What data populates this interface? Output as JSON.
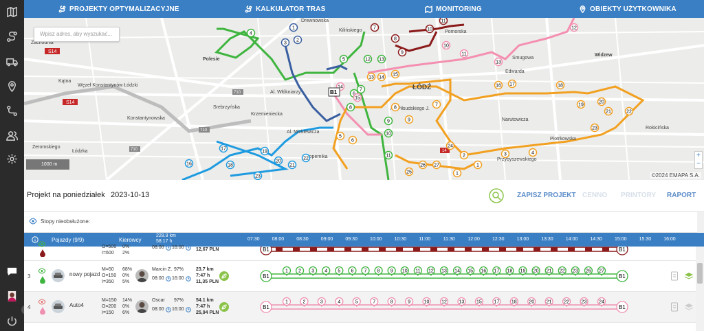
{
  "nav": {
    "items": [
      {
        "label": "PROJEKTY OPTYMALIZACYJNE",
        "icon": "route-icon"
      },
      {
        "label": "KALKULATOR TRAS",
        "icon": "route-icon"
      },
      {
        "label": "MONITORING",
        "icon": "map-icon"
      },
      {
        "label": "OBIEKTY UŻYTKOWNIKA",
        "icon": "pin-icon"
      }
    ]
  },
  "map": {
    "search_placeholder": "Wpisz adres, aby wyszukać...",
    "copyright": "©2024 EMAPA S.A.",
    "scale_label": "1000 m",
    "zoom_in": "+",
    "zoom_out": "−",
    "labels": [
      "Drewnowska",
      "Pomorska",
      "Widzew",
      "Polesie",
      "Zachodnia",
      "Węzeł Konstantynów Łódzki",
      "S14",
      "710",
      "ŁÓDŹ",
      "Al. Piłsudskiego J.",
      "Srebrzyńska",
      "Konstantynowska",
      "Krzemieniecka",
      "Żeromskiego",
      "Kopernika",
      "Al. Włókniarzy",
      "Przybyszewskiego",
      "Rokicińska",
      "Łódzka",
      "Kilińskiego",
      "Narutowicza",
      "Piotrkowska",
      "Al. Mickiewicza",
      "Smugowa",
      "Edwarda",
      "Kątna"
    ],
    "stops_text": [
      "B1"
    ]
  },
  "project": {
    "name": "Projekt na poniedziałek",
    "date": "2023-10-13",
    "buttons": [
      {
        "label": "ZAPISZ PROJEKT",
        "enabled": true
      },
      {
        "label": "CENNO",
        "enabled": false
      },
      {
        "label": "PRINTORY",
        "enabled": false
      },
      {
        "label": "RAPORT",
        "enabled": true
      }
    ]
  },
  "unserved": {
    "label": "Stopy nieobsłużone:"
  },
  "table": {
    "vehicles_header": "Pojazdy (9/9)",
    "drivers_header": "Kierowcy",
    "total_km": "228.9 km",
    "total_time": "58:17 h",
    "times": [
      "07:30",
      "08:00",
      "08:30",
      "09:00",
      "09:30",
      "10:00",
      "10:30",
      "11:00",
      "11:30",
      "12:00",
      "12:30",
      "13:00",
      "13:30",
      "14:00",
      "14:30",
      "15:00",
      "15:30",
      "16:00"
    ],
    "rows": [
      {
        "num": "",
        "vehicle": "",
        "caps": [
          "O=500",
          "I=600"
        ],
        "pcts": [
          "0%",
          "2%"
        ],
        "driver": "",
        "pct": "",
        "start": "08:00",
        "end": "16:00",
        "km": "",
        "time": "",
        "cost": "12,67 PLN",
        "color": "#8b1a1a",
        "depot": "B1",
        "stops": [],
        "partial": true
      },
      {
        "num": "3",
        "vehicle": "nowy pojazd",
        "caps": [
          "M=50",
          "O=150",
          "I=350"
        ],
        "pcts": [
          "68%",
          "0%",
          "5%"
        ],
        "driver": "Marcin Z.",
        "pct": "97%",
        "start": "08:00",
        "end": "16:00",
        "km": "23.7 km",
        "time": "7:47 h",
        "cost": "11,35 PLN",
        "color": "#3fb53f",
        "depot": "B1",
        "stops": [
          "1",
          "2",
          "3",
          "4",
          "5",
          "6",
          "7",
          "8",
          "9",
          "10",
          "11",
          "12",
          "13",
          "14",
          "15",
          "16",
          "17",
          "18",
          "19",
          "20",
          "21",
          "22",
          "23",
          "26",
          "27"
        ]
      },
      {
        "num": "4",
        "vehicle": "Auto4",
        "caps": [
          "M=150",
          "O=200",
          "I=150"
        ],
        "pcts": [
          "14%",
          "0%",
          "6%"
        ],
        "driver": "Oscar",
        "pct": "97%",
        "start": "08:00",
        "end": "16:00",
        "km": "54.1 km",
        "time": "7:47 h",
        "cost": "25,94 PLN",
        "color": "#f08fb0",
        "depot": "B1",
        "stops": [
          "1",
          "2",
          "3",
          "4",
          "5",
          "7",
          "8",
          "9",
          "10",
          "12",
          "13",
          "15",
          "17",
          "18",
          "20",
          "21",
          "22",
          "23",
          "24"
        ]
      }
    ]
  },
  "colors": {
    "primary": "#3a7fc4",
    "green_route": "#3fb53f",
    "orange_route": "#f2a020",
    "blue_route": "#1e9be0",
    "pink_route": "#f48fb1",
    "darkred_route": "#8b1a1a",
    "navy_route": "#3a5fa0"
  }
}
